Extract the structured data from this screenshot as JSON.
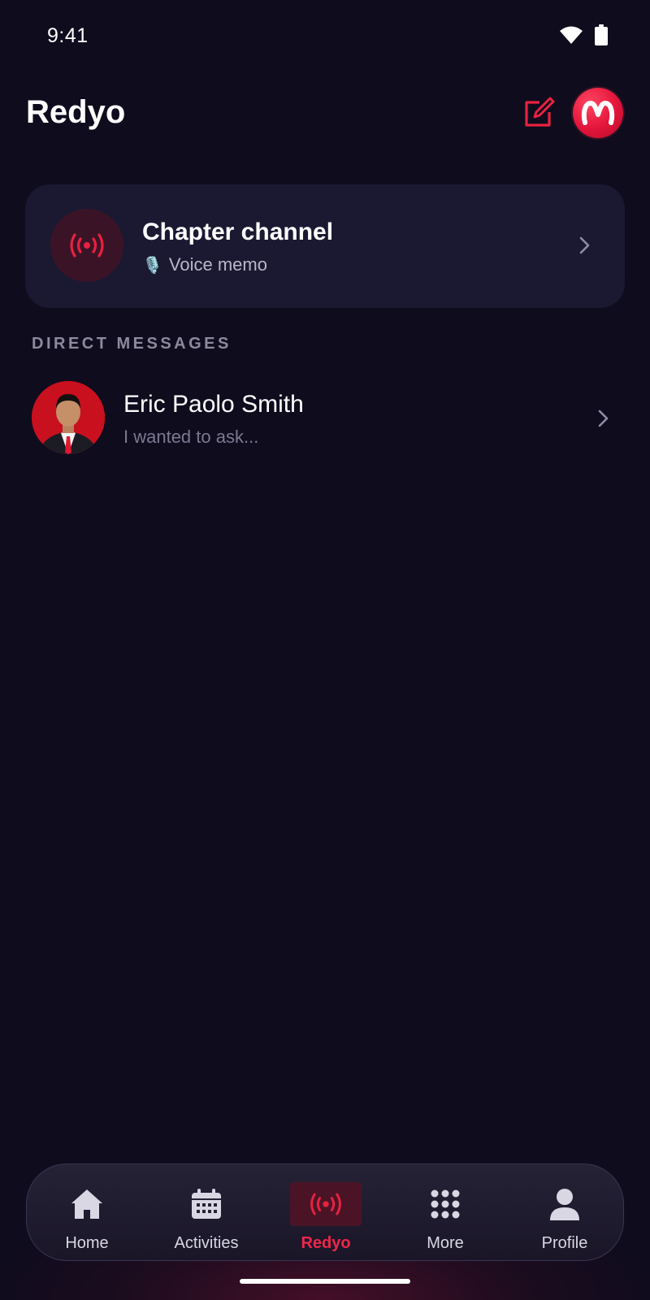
{
  "status_bar": {
    "time": "9:41"
  },
  "header": {
    "title": "Redyo"
  },
  "channel": {
    "title": "Chapter channel",
    "subtitle": "Voice memo",
    "subtitle_emoji": "🎙️"
  },
  "direct_messages": {
    "section_label": "DIRECT MESSAGES",
    "items": [
      {
        "name": "Eric Paolo Smith",
        "preview": "I wanted to ask..."
      }
    ]
  },
  "bottom_nav": {
    "items": [
      {
        "label": "Home",
        "icon": "home-icon",
        "active": false
      },
      {
        "label": "Activities",
        "icon": "calendar-icon",
        "active": false
      },
      {
        "label": "Redyo",
        "icon": "broadcast-icon",
        "active": true
      },
      {
        "label": "More",
        "icon": "grid-icon",
        "active": false
      },
      {
        "label": "Profile",
        "icon": "person-icon",
        "active": false
      }
    ]
  },
  "colors": {
    "accent": "#e8213f",
    "background": "#0e0c1d",
    "card": "#1b1832"
  }
}
